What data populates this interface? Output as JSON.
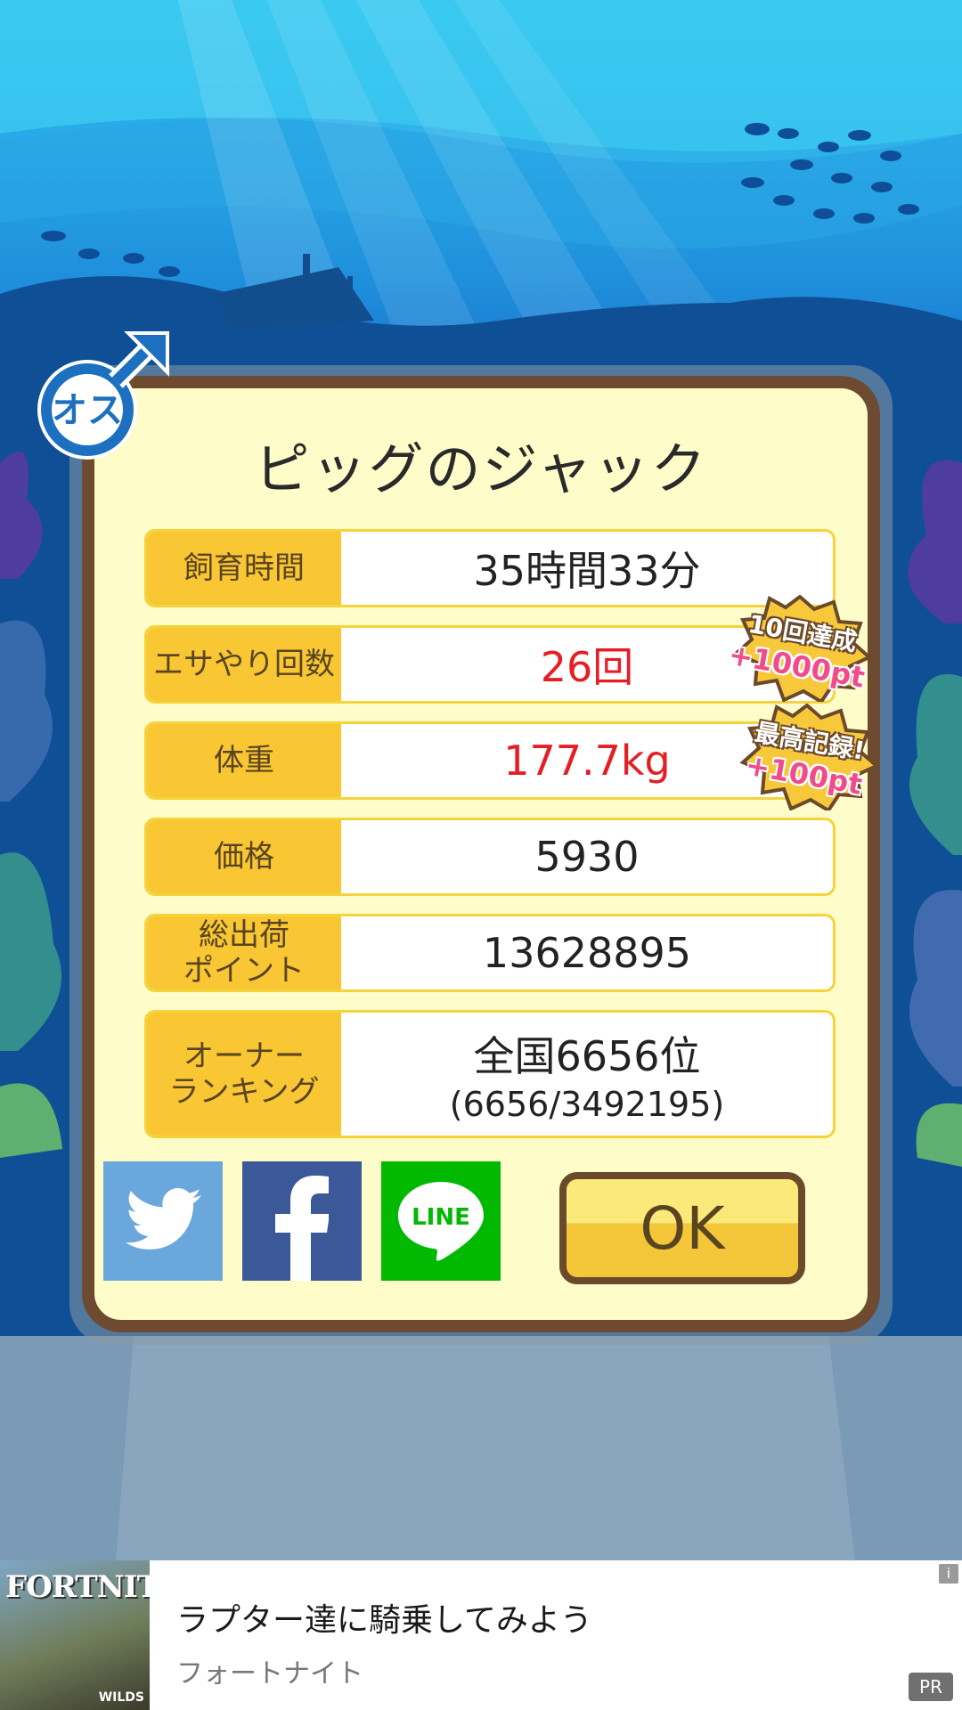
{
  "dialog": {
    "title": "ピッグのジャック",
    "gender_badge": "オス",
    "stats": [
      {
        "label": "飼育時間",
        "value": "35時間33分",
        "highlight": false
      },
      {
        "label": "エサやり回数",
        "value": "26回",
        "highlight": true
      },
      {
        "label": "体重",
        "value": "177.7kg",
        "highlight": true
      },
      {
        "label": "価格",
        "value": "5930",
        "highlight": false
      },
      {
        "label_line1": "総出荷",
        "label_line2": "ポイント",
        "value": "13628895",
        "highlight": false
      },
      {
        "label_line1": "オーナー",
        "label_line2": "ランキング",
        "value": "全国6656位",
        "sub_value": "(6656/3492195)",
        "highlight": false
      }
    ],
    "bonuses": [
      {
        "line1": "10回達成",
        "line2": "+1000pt"
      },
      {
        "line1": "最高記録!",
        "line2": "+100pt"
      }
    ],
    "share": {
      "twitter_icon": "twitter-bird-icon",
      "facebook_icon": "facebook-f-icon",
      "line_label": "LINE"
    },
    "ok_label": "OK"
  },
  "ad": {
    "thumb_logo": "FORTNITE",
    "thumb_sub": "WILDS",
    "title": "ラプター達に騎乗してみよう",
    "advertiser": "フォートナイト",
    "info": "i",
    "pr": "PR"
  },
  "colors": {
    "label_bg": "#f8c733",
    "highlight_text": "#e51e24",
    "frame": "#6e4a30",
    "panel": "#fefcc8"
  }
}
